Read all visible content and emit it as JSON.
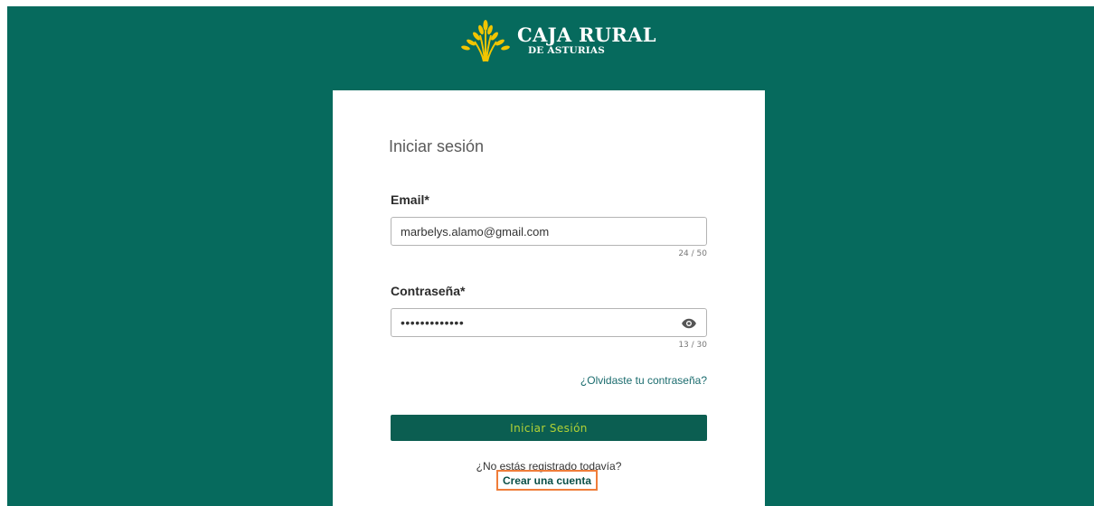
{
  "brand": {
    "name": "CAJA RURAL",
    "subtitle": "DE ASTURIAS",
    "logo_icon": "wheat-icon"
  },
  "colors": {
    "page_background": "#066a5d",
    "button": "#0b5e51",
    "button_text": "#b2d235",
    "link": "#1b6c6e",
    "highlight": "#ef7d3a"
  },
  "login": {
    "title": "Iniciar sesión",
    "email": {
      "label": "Email*",
      "value": "marbelys.alamo@gmail.com",
      "counter": "24 / 50"
    },
    "password": {
      "label": "Contraseña*",
      "value": "•••••••••••••",
      "counter": "13 / 30",
      "toggle_icon": "eye-icon"
    },
    "forgot_link": "¿Olvidaste tu contraseña?",
    "submit_label": "Iniciar Sesión",
    "not_registered": "¿No estás registrado todavía?",
    "create_account": "Crear una cuenta"
  }
}
